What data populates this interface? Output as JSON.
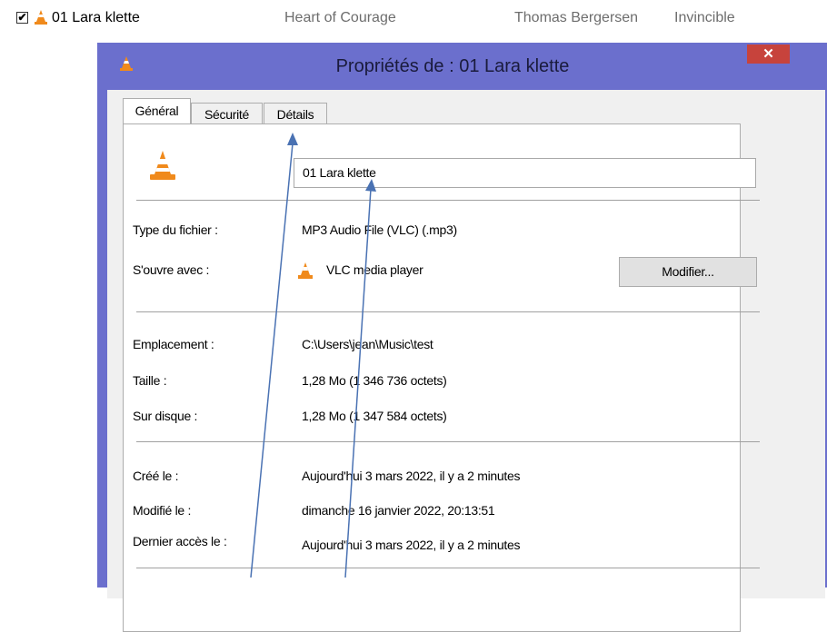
{
  "file_row": {
    "checked": "✔",
    "name": "01 Lara klette",
    "title": "Heart of Courage",
    "artist": "Thomas Bergersen",
    "album": "Invincible"
  },
  "dialog": {
    "title": "Propriétés de : 01 Lara klette",
    "close_label": "✕",
    "tabs": [
      "Général",
      "Sécurité",
      "Détails"
    ],
    "file_name_value": "01 Lara klette",
    "file_type_label": "Type du fichier :",
    "file_type_value": "MP3 Audio File (VLC) (.mp3)",
    "opens_with_label": "S'ouvre avec :",
    "opens_with_value": "VLC media player",
    "modify_button": "Modifier...",
    "location_label": "Emplacement :",
    "location_value": "C:\\Users\\jean\\Music\\test",
    "size_label": "Taille :",
    "size_value": "1,28 Mo (1 346 736 octets)",
    "disk_size_label": "Sur disque :",
    "disk_size_value": "1,28 Mo (1 347 584 octets)",
    "created_label": "Créé le :",
    "created_value": "Aujourd'hui 3 mars 2022, il y a 2 minutes",
    "modified_label": "Modifié le :",
    "modified_value": "dimanche 16 janvier 2022, 20:13:51",
    "accessed_label": "Dernier accès le :",
    "accessed_value": "Aujourd'hui 3 mars 2022, il y a 2 minutes"
  },
  "colors": {
    "window_frame": "#6b6fcd",
    "close_button": "#c7433c",
    "arrow": "#4a72b3",
    "vlc_orange": "#f08a1c"
  },
  "icons": [
    "checkbox-icon",
    "vlc-cone-icon",
    "close-icon"
  ]
}
